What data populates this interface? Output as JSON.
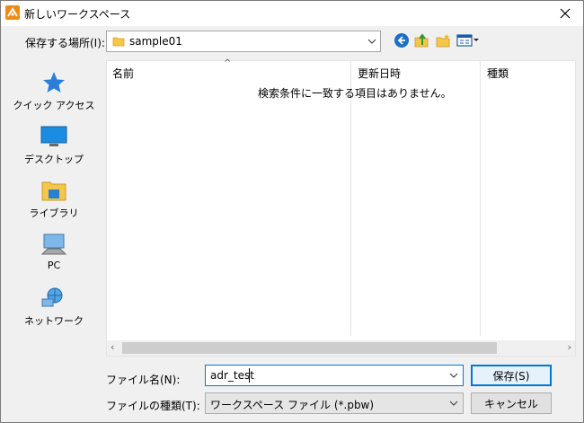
{
  "window": {
    "title": "新しいワークスペース"
  },
  "location": {
    "label": "保存する場所(I):",
    "value": "sample01"
  },
  "places": [
    {
      "label": "クイック アクセス",
      "icon": "star-icon"
    },
    {
      "label": "デスクトップ",
      "icon": "desktop-icon"
    },
    {
      "label": "ライブラリ",
      "icon": "library-folder-icon"
    },
    {
      "label": "PC",
      "icon": "pc-icon"
    },
    {
      "label": "ネットワーク",
      "icon": "network-icon"
    }
  ],
  "filelist": {
    "columns": [
      "名前",
      "更新日時",
      "種類"
    ],
    "empty_message": "検索条件に一致する項目はありません。"
  },
  "filename": {
    "label": "ファイル名(N):",
    "value": "adr_test"
  },
  "filetype": {
    "label": "ファイルの種類(T):",
    "value": "ワークスペース ファイル (*.pbw)"
  },
  "buttons": {
    "save": "保存(S)",
    "cancel": "キャンセル"
  },
  "colors": {
    "accent": "#0078d7",
    "app_icon": "#f08a16",
    "folder": "#f5c64a"
  }
}
